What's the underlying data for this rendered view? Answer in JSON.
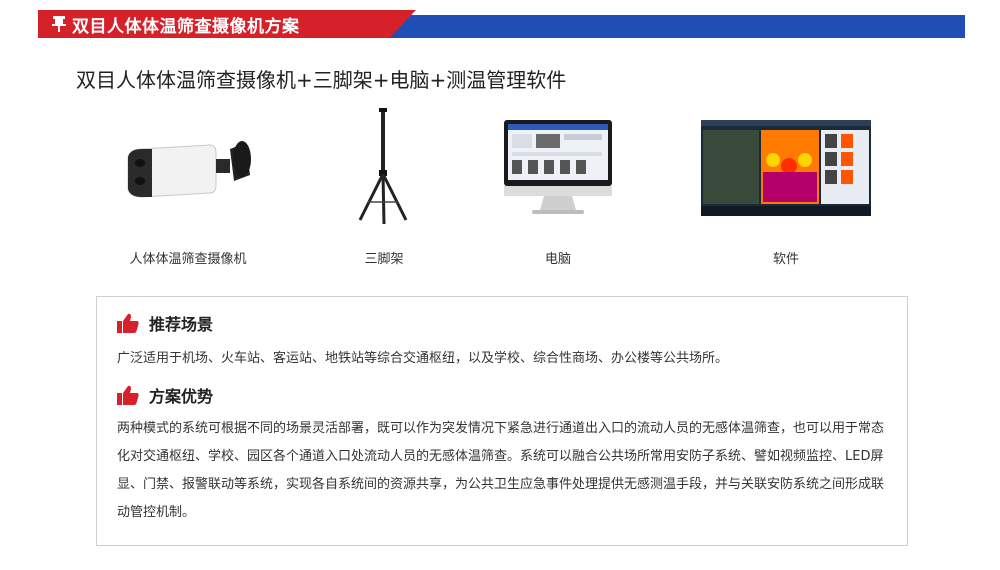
{
  "banner": {
    "title": "双目人体体温筛查摄像机方案",
    "accent_red": "#d6202a",
    "accent_blue": "#1f4fb5",
    "icon": "pin-icon"
  },
  "subtitle": "双目人体体温筛查摄像机+三脚架+电脑+测温管理软件",
  "products": [
    {
      "label": "人体体温筛查摄像机",
      "icon": "camera-icon"
    },
    {
      "label": "三脚架",
      "icon": "tripod-icon"
    },
    {
      "label": "电脑",
      "icon": "computer-icon"
    },
    {
      "label": "软件",
      "icon": "software-screenshot"
    }
  ],
  "sections": [
    {
      "heading": "推荐场景",
      "icon": "thumbs-up-icon",
      "text": "广泛适用于机场、火车站、客运站、地铁站等综合交通枢纽，以及学校、综合性商场、办公楼等公共场所。"
    },
    {
      "heading": "方案优势",
      "icon": "thumbs-up-icon",
      "text": "两种模式的系统可根据不同的场景灵活部署，既可以作为突发情况下紧急进行通道出入口的流动人员的无感体温筛查，也可以用于常态化对交通枢纽、学校、园区各个通道入口处流动人员的无感体温筛查。系统可以融合公共场所常用安防子系统、譬如视频监控、LED屏显、门禁、报警联动等系统，实现各自系统间的资源共享，为公共卫生应急事件处理提供无感测温手段，并与关联安防系统之间形成联动管控机制。"
    }
  ]
}
